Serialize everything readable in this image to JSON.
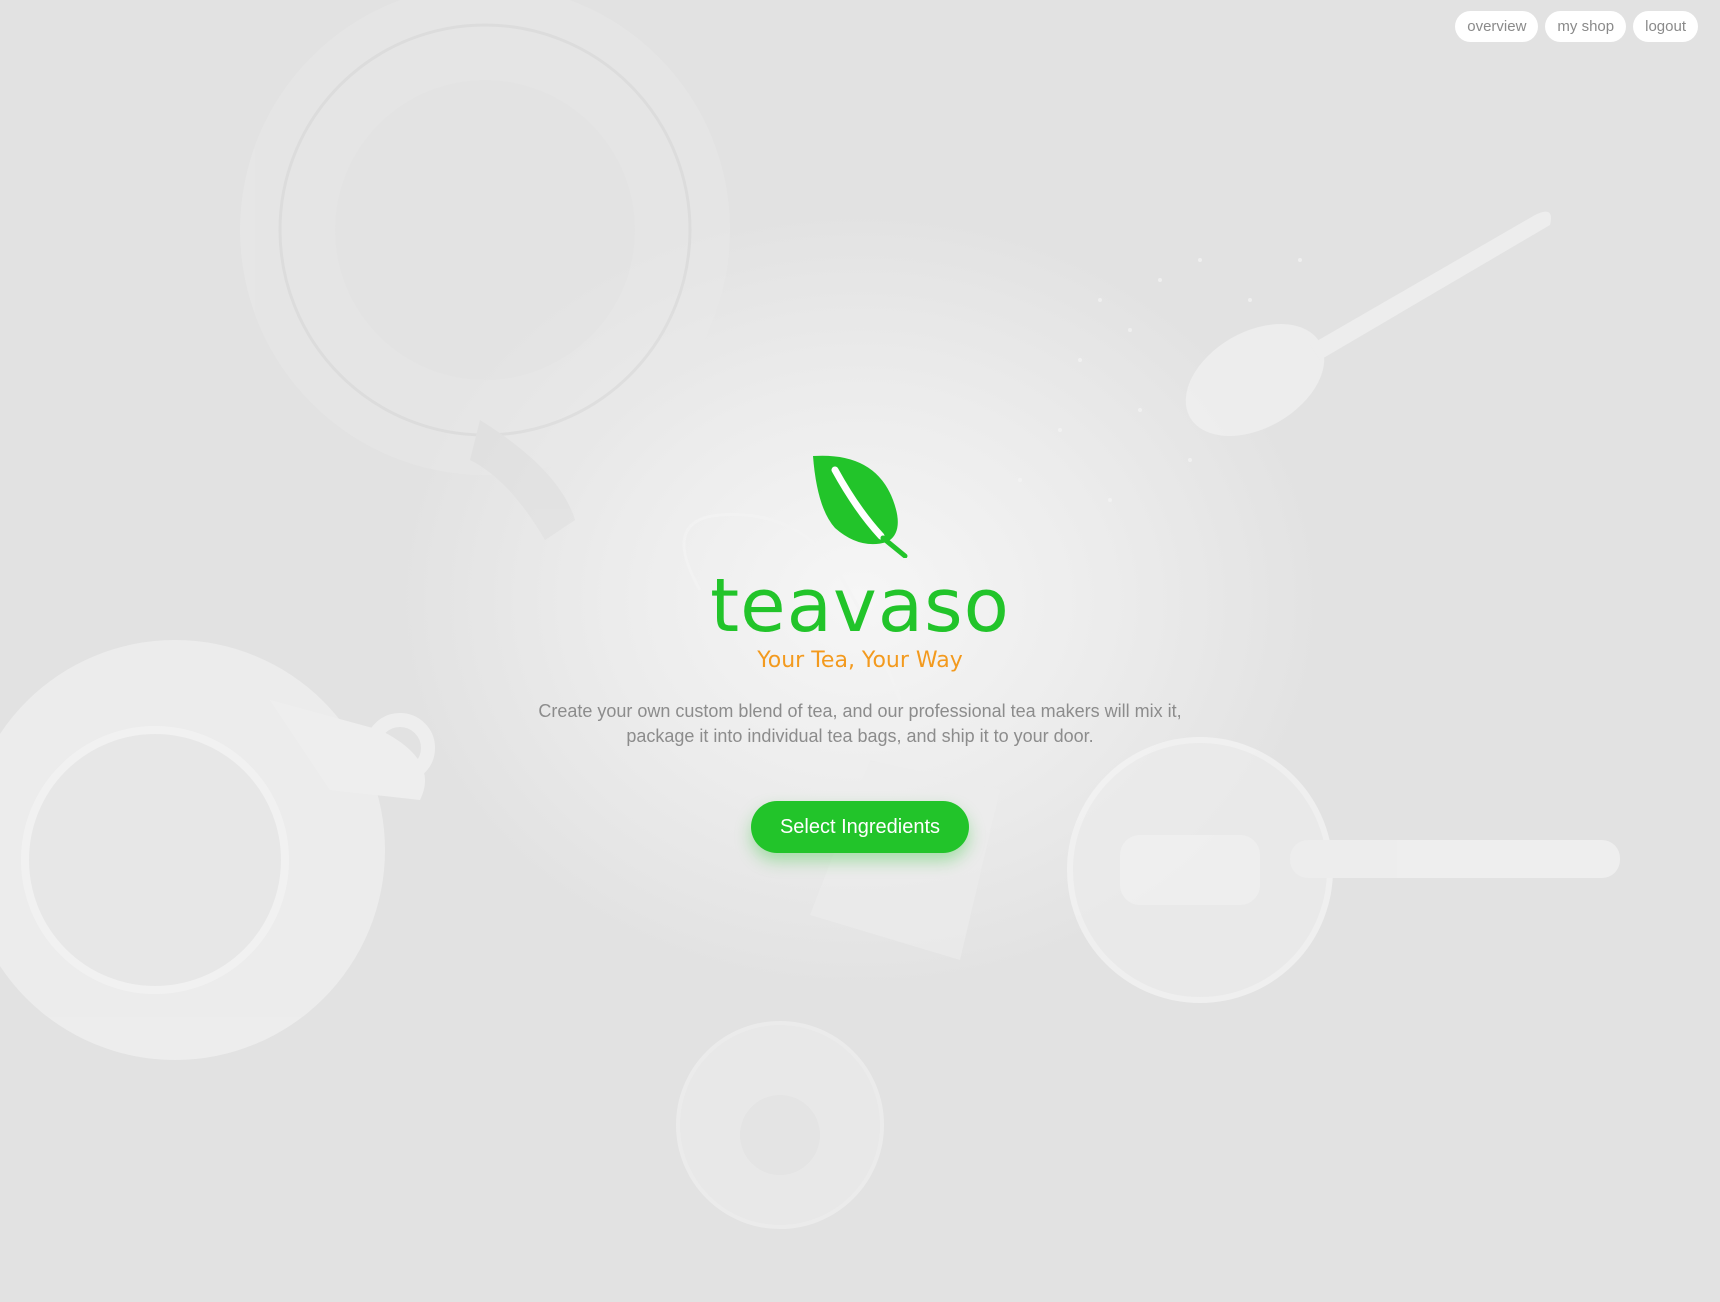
{
  "nav": {
    "items": [
      {
        "label": "overview"
      },
      {
        "label": "my shop"
      },
      {
        "label": "logout"
      }
    ]
  },
  "hero": {
    "logo_icon": "leaf-icon",
    "brand": "teavaso",
    "tagline": "Your Tea, Your Way",
    "description_line1": "Create your own custom blend of tea, and our professional tea makers will mix it,",
    "description_line2": "package it into individual tea bags, and ship it to your door.",
    "cta_label": "Select Ingredients"
  },
  "colors": {
    "background": "#e2e2e2",
    "brand_green": "#22c42a",
    "tagline_orange": "#f39a1e",
    "body_text": "#8c8c8c"
  }
}
